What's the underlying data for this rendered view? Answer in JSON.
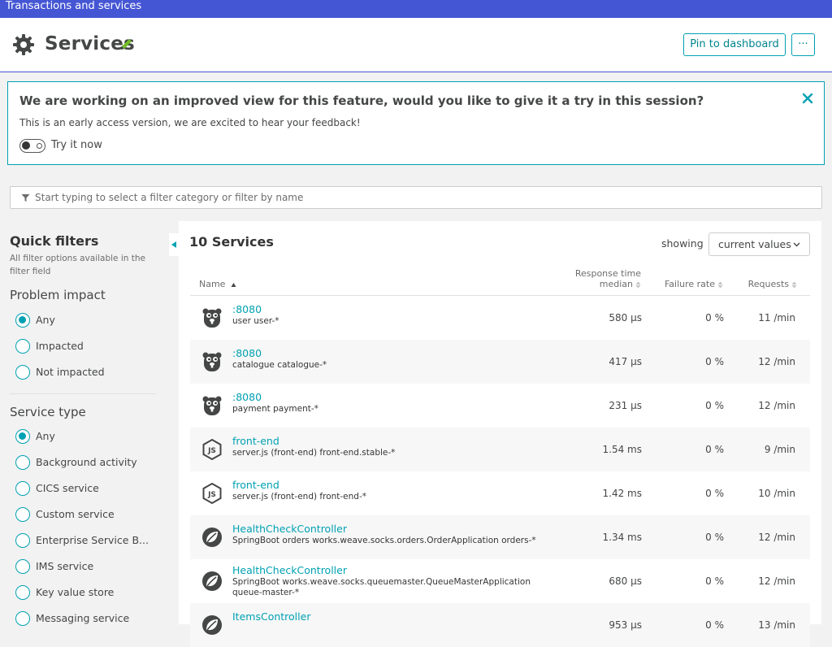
{
  "topbar": {
    "title": "Transactions and services"
  },
  "header": {
    "title": "Services",
    "pin_label": "Pin to dashboard",
    "more_label": "···"
  },
  "banner": {
    "title": "We are working on an improved view for this feature, would you like to give it a try in this session?",
    "subtitle": "This is an early access version, we are excited to hear your feedback!",
    "toggle_label": "Try it now",
    "toggle_on": false
  },
  "filter": {
    "placeholder": "Start typing to select a filter category or filter by name"
  },
  "quick_filters": {
    "title": "Quick filters",
    "subtitle": "All filter options available in the filter field",
    "problem_impact": {
      "label": "Problem impact",
      "options": [
        "Any",
        "Impacted",
        "Not impacted"
      ],
      "selected": "Any"
    },
    "service_type": {
      "label": "Service type",
      "options": [
        "Any",
        "Background activity",
        "CICS service",
        "Custom service",
        "Enterprise Service B...",
        "IMS service",
        "Key value store",
        "Messaging service"
      ],
      "selected": "Any"
    }
  },
  "services": {
    "title": "10 Services",
    "showing_label": "showing",
    "showing_value": "current values",
    "columns": {
      "name": "Name",
      "response_time_1": "Response time",
      "response_time_2": "median",
      "failure_rate": "Failure rate",
      "requests": "Requests"
    },
    "rows": [
      {
        "icon": "go-gopher-icon",
        "name": ":8080",
        "desc": "user user-*",
        "rt": "580 µs",
        "fr": "0 %",
        "rq": "11 /min"
      },
      {
        "icon": "go-gopher-icon",
        "name": ":8080",
        "desc": "catalogue catalogue-*",
        "rt": "417 µs",
        "fr": "0 %",
        "rq": "12 /min"
      },
      {
        "icon": "go-gopher-icon",
        "name": ":8080",
        "desc": "payment payment-*",
        "rt": "231 µs",
        "fr": "0 %",
        "rq": "12 /min"
      },
      {
        "icon": "nodejs-icon",
        "name": "front-end",
        "desc": "server.js (front-end) front-end.stable-*",
        "rt": "1.54 ms",
        "fr": "0 %",
        "rq": "9 /min"
      },
      {
        "icon": "nodejs-icon",
        "name": "front-end",
        "desc": "server.js (front-end) front-end-*",
        "rt": "1.42 ms",
        "fr": "0 %",
        "rq": "10 /min"
      },
      {
        "icon": "spring-icon",
        "name": "HealthCheckController",
        "desc": "SpringBoot orders works.weave.socks.orders.OrderApplication orders-*",
        "rt": "1.34 ms",
        "fr": "0 %",
        "rq": "12 /min"
      },
      {
        "icon": "spring-icon",
        "name": "HealthCheckController",
        "desc": "SpringBoot works.weave.socks.queuemaster.QueueMasterApplication queue-master-*",
        "rt": "680 µs",
        "fr": "0 %",
        "rq": "12 /min"
      },
      {
        "icon": "spring-icon",
        "name": "ItemsController",
        "desc": "",
        "rt": "953 µs",
        "fr": "0 %",
        "rq": "13 /min"
      }
    ]
  },
  "colors": {
    "accent": "#00a1b2",
    "topbar": "#4556d4",
    "text": "#353535"
  }
}
